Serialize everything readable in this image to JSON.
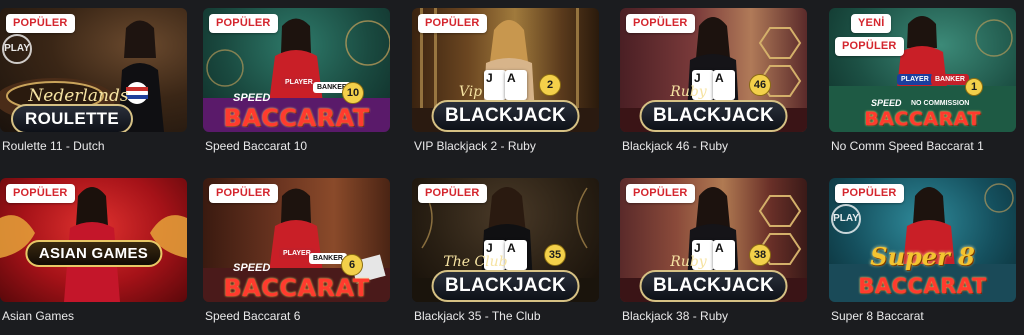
{
  "games": [
    {
      "title": "Roulette 11 - Dutch",
      "badges": [
        "POPÜLER"
      ],
      "logo_line1": "Nederlands",
      "logo_line2": "ROULETTE",
      "overlay": "PLAY"
    },
    {
      "title": "Speed Baccarat 10",
      "badges": [
        "POPÜLER"
      ],
      "logo_line1": "SPEED",
      "logo_line2": "BACCARAT",
      "number": "10",
      "chip_labels": [
        "PLAYER",
        "BANKER"
      ]
    },
    {
      "title": "VIP Blackjack 2 - Ruby",
      "badges": [
        "POPÜLER"
      ],
      "logo_line1": "Vip",
      "logo_line2": "BLACKJACK",
      "number": "2",
      "card_ranks": [
        "J",
        "A"
      ]
    },
    {
      "title": "Blackjack 46 - Ruby",
      "badges": [
        "POPÜLER"
      ],
      "logo_line1": "Ruby",
      "logo_line2": "BLACKJACK",
      "number": "46",
      "card_ranks": [
        "J",
        "A"
      ]
    },
    {
      "title": "No Comm Speed Baccarat 1",
      "badges": [
        "YENİ",
        "POPÜLER"
      ],
      "logo_line1": "SPEED",
      "logo_line1b": "NO COMMISSION",
      "logo_line2": "BACCARAT",
      "number": "1",
      "chip_labels": [
        "PLAYER",
        "BANKER"
      ]
    },
    {
      "title": "Asian Games",
      "badges": [
        "POPÜLER"
      ],
      "logo_line2": "ASIAN GAMES"
    },
    {
      "title": "Speed Baccarat 6",
      "badges": [
        "POPÜLER"
      ],
      "logo_line1": "SPEED",
      "logo_line2": "BACCARAT",
      "number": "6",
      "chip_labels": [
        "PLAYER",
        "BANKER"
      ]
    },
    {
      "title": "Blackjack 35 - The Club",
      "badges": [
        "POPÜLER"
      ],
      "logo_line1": "The Club",
      "logo_line2": "BLACKJACK",
      "number": "35",
      "card_ranks": [
        "J",
        "A"
      ]
    },
    {
      "title": "Blackjack 38 - Ruby",
      "badges": [
        "POPÜLER"
      ],
      "logo_line1": "Ruby",
      "logo_line2": "BLACKJACK",
      "number": "38",
      "card_ranks": [
        "J",
        "A"
      ]
    },
    {
      "title": "Super 8 Baccarat",
      "badges": [
        "POPÜLER"
      ],
      "logo_line1": "Super 8",
      "logo_line2": "BACCARAT",
      "overlay": "PLAY"
    }
  ],
  "colors": {
    "page_bg": "#1b1c1f",
    "badge_bg": "#ffffff",
    "badge_text": "#d4262e",
    "title_text": "#e9e9ea"
  }
}
